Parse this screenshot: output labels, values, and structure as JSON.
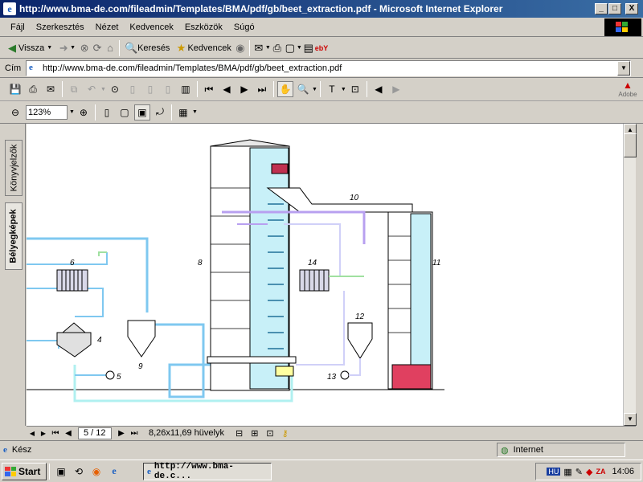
{
  "window": {
    "title": "http://www.bma-de.com/fileadmin/Templates/BMA/pdf/gb/beet_extraction.pdf - Microsoft Internet Explorer",
    "buttons": [
      "_",
      "□",
      "X"
    ]
  },
  "menu": [
    "Fájl",
    "Szerkesztés",
    "Nézet",
    "Kedvencek",
    "Eszközök",
    "Súgó"
  ],
  "toolbar": {
    "back_label": "Vissza",
    "search_label": "Keresés",
    "favorites_label": "Kedvencek"
  },
  "address": {
    "label": "Cím",
    "url": "http://www.bma-de.com/fileadmin/Templates/BMA/pdf/gb/beet_extraction.pdf"
  },
  "pdf_toolbar": {
    "zoom": "123%",
    "adobe_label": "Adobe"
  },
  "side_tabs": [
    "Könyvjelzők",
    "Bélyegképek"
  ],
  "diagram": {
    "labels": [
      "4",
      "5",
      "6",
      "8",
      "9",
      "10",
      "11",
      "12",
      "13",
      "14"
    ]
  },
  "pdf_nav": {
    "page": "5 / 12",
    "page_size": "8,26x11,69 hüvelyk"
  },
  "status": {
    "text": "Kész",
    "zone": "Internet"
  },
  "taskbar": {
    "start": "Start",
    "task_item": "http://www.bma-de.c...",
    "lang": "HU",
    "clock": "14:06"
  }
}
